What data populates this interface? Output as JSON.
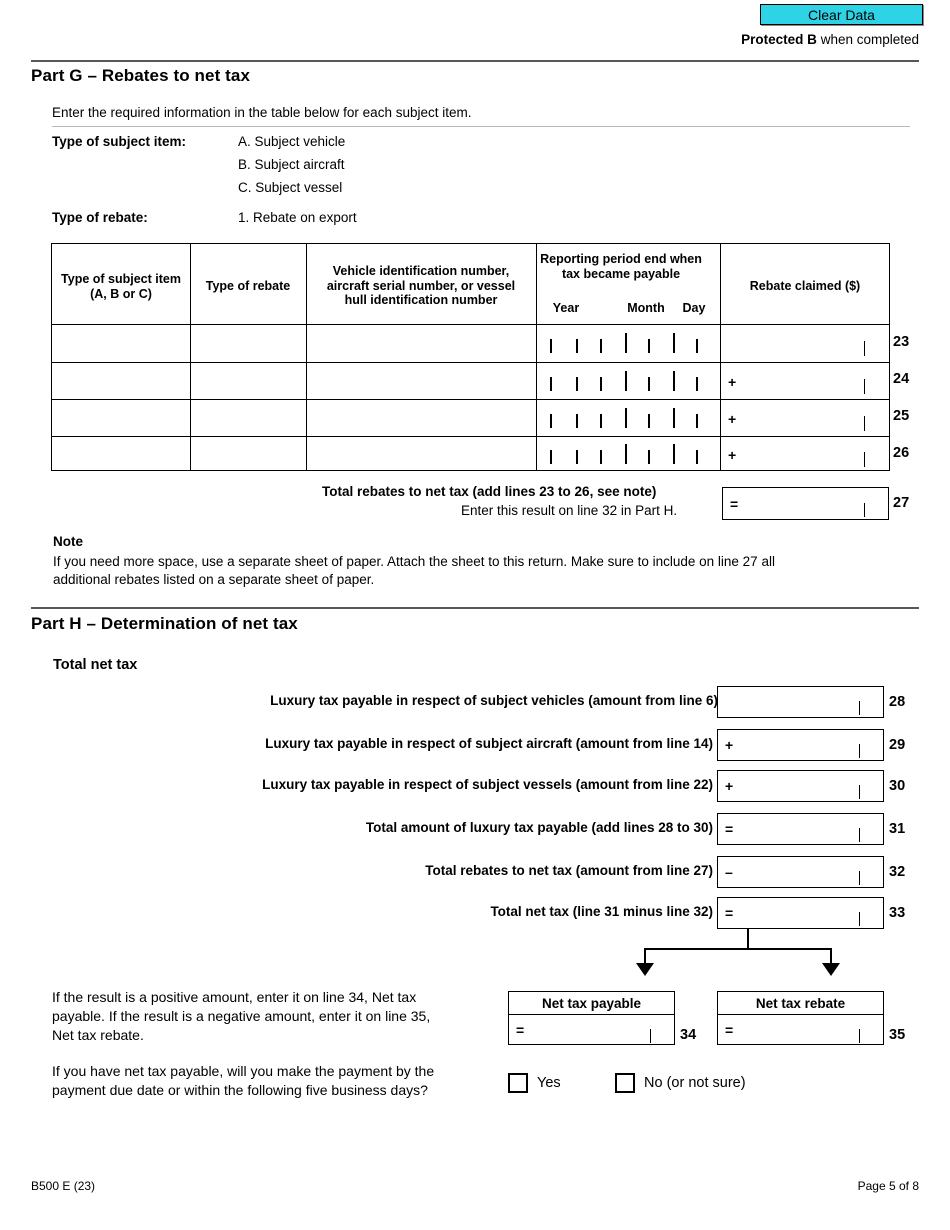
{
  "header": {
    "clear_data_label": "Clear Data",
    "protected_label": "Protected B",
    "protected_suffix": " when completed"
  },
  "part_g": {
    "heading": "Part G – Rebates to net tax",
    "intro": "Enter the required information in the table below for each subject item.",
    "type_of_subject_item_label": "Type of subject item:",
    "subject_item_options": [
      "A. Subject vehicle",
      "B. Subject aircraft",
      "C. Subject vessel"
    ],
    "type_of_rebate_label": "Type of rebate:",
    "rebate_options": [
      "1.  Rebate on export"
    ],
    "table": {
      "columns": [
        "Type of subject item\n(A, B or C)",
        "Type of rebate",
        "Vehicle identification number,\naircraft serial number, or vessel\nhull identification number",
        "Reporting period end when\ntax became payable",
        "Rebate claimed ($)"
      ],
      "col1_line1": "Type of subject item",
      "col1_line2": "(A, B or C)",
      "col2_line1": "Type of rebate",
      "col3_line1": "Vehicle identification number,",
      "col3_line2": "aircraft serial number, or vessel",
      "col3_line3": "hull identification number",
      "col4_line1": "Reporting period end when",
      "col4_line2": "tax became payable",
      "col4_sub_year": "Year",
      "col4_sub_month": "Month",
      "col4_sub_day": "Day",
      "col5_line1": "Rebate claimed ($)",
      "rows": [
        {
          "line_no": "23",
          "subject_item": "",
          "rebate_type": "",
          "identification_number": "",
          "year": "",
          "month": "",
          "day": "",
          "rebate_claimed": "",
          "operator": ""
        },
        {
          "line_no": "24",
          "subject_item": "",
          "rebate_type": "",
          "identification_number": "",
          "year": "",
          "month": "",
          "day": "",
          "rebate_claimed": "",
          "operator": "+"
        },
        {
          "line_no": "25",
          "subject_item": "",
          "rebate_type": "",
          "identification_number": "",
          "year": "",
          "month": "",
          "day": "",
          "rebate_claimed": "",
          "operator": "+"
        },
        {
          "line_no": "26",
          "subject_item": "",
          "rebate_type": "",
          "identification_number": "",
          "year": "",
          "month": "",
          "day": "",
          "rebate_claimed": "",
          "operator": "+"
        }
      ]
    },
    "total_line1": "Total rebates to net tax (add lines 23 to 26, see note)",
    "total_line2": "Enter this result on line 32 in Part H.",
    "total_operator": "=",
    "total_value": "",
    "total_line_no": "27",
    "note_heading": "Note",
    "note_line1": "If you need more space, use a separate sheet of paper. Attach the sheet to this return. Make sure to include on line 27 all",
    "note_line2": "additional rebates listed on a separate sheet of paper."
  },
  "part_h": {
    "heading": "Part H – Determination of net tax",
    "subheading": "Total net tax",
    "lines": [
      {
        "label": "Luxury tax payable in respect of subject vehicles (amount from line 6)",
        "operator": "",
        "value": "",
        "line_no": "28"
      },
      {
        "label": "Luxury tax payable in respect of subject aircraft (amount from line 14)",
        "operator": "+",
        "value": "",
        "line_no": "29"
      },
      {
        "label": "Luxury tax payable in respect of subject vessels (amount from line 22)",
        "operator": "+",
        "value": "",
        "line_no": "30"
      },
      {
        "label": "Total amount of luxury tax payable (add lines 28 to 30)",
        "operator": "=",
        "value": "",
        "line_no": "31"
      },
      {
        "label": "Total rebates to net tax (amount from line 27)",
        "operator": "–",
        "value": "",
        "line_no": "32"
      },
      {
        "label": "Total net tax (line 31 minus line 32)",
        "operator": "=",
        "value": "",
        "line_no": "33"
      }
    ],
    "result_note_line1": "If the result is a positive amount, enter it on line 34, Net tax",
    "result_note_line2": "payable. If the result is a negative amount, enter it on line 35,",
    "result_note_line3": "Net tax rebate.",
    "payment_question_line1": "If you have net tax payable, will you make the payment by the",
    "payment_question_line2": "payment due date or within the following five business days?",
    "net_tax_payable": {
      "title": "Net tax payable",
      "operator": "=",
      "value": "",
      "line_no": "34"
    },
    "net_tax_rebate": {
      "title": "Net tax rebate",
      "operator": "=",
      "value": "",
      "line_no": "35"
    },
    "yes_label": "Yes",
    "no_label": "No (or not sure)"
  },
  "footer": {
    "form_code": "B500 E (23)",
    "page_label": "Page 5 of 8"
  },
  "colors": {
    "clear_data_bg": "#2ed3e6",
    "rule": "#58585a",
    "thin_rule": "#b9b9bb"
  }
}
